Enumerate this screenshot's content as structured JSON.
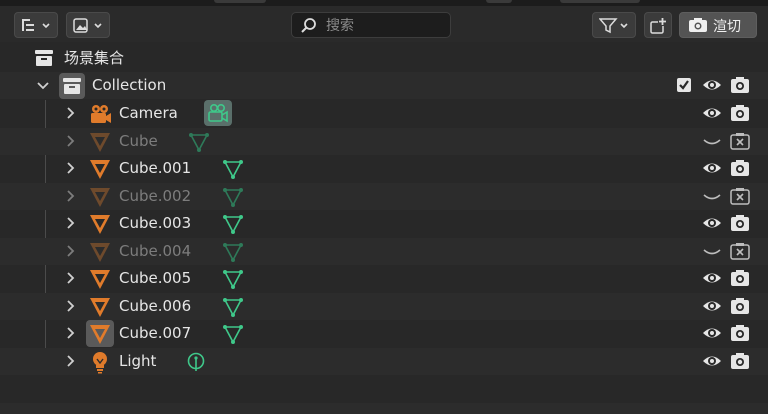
{
  "search": {
    "placeholder": "搜索"
  },
  "header": {
    "render_label": "渲切"
  },
  "scene_collection": {
    "label": "场景集合"
  },
  "collection": {
    "label": "Collection"
  },
  "objects": [
    {
      "name": "Camera",
      "type": "camera",
      "visible": true
    },
    {
      "name": "Cube",
      "type": "mesh",
      "visible": false
    },
    {
      "name": "Cube.001",
      "type": "mesh",
      "visible": true
    },
    {
      "name": "Cube.002",
      "type": "mesh",
      "visible": false
    },
    {
      "name": "Cube.003",
      "type": "mesh",
      "visible": true
    },
    {
      "name": "Cube.004",
      "type": "mesh",
      "visible": false
    },
    {
      "name": "Cube.005",
      "type": "mesh",
      "visible": true
    },
    {
      "name": "Cube.006",
      "type": "mesh",
      "visible": true
    },
    {
      "name": "Cube.007",
      "type": "mesh",
      "visible": true
    },
    {
      "name": "Light",
      "type": "light",
      "visible": true
    }
  ],
  "colors": {
    "object_orange": "#e07b2b",
    "data_green": "#3fc88a",
    "background": "#282828",
    "icon_white": "#e6e6e6"
  }
}
